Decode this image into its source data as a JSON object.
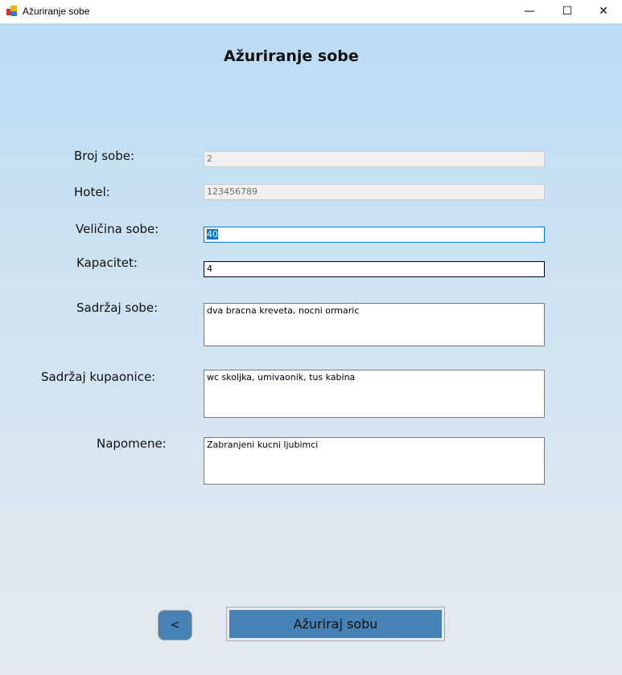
{
  "window": {
    "title": "Ažuriranje sobe",
    "minimize": "—",
    "maximize": "☐",
    "close": "✕"
  },
  "heading": "Ažuriranje sobe",
  "fields": {
    "broj_sobe": {
      "label": "Broj sobe:",
      "value": "2"
    },
    "hotel": {
      "label": "Hotel:",
      "value": "123456789"
    },
    "velicina": {
      "label": "Veličina sobe:",
      "value": "40"
    },
    "kapacitet": {
      "label": "Kapacitet:",
      "value": "4"
    },
    "sadrzaj_sobe": {
      "label": "Sadržaj sobe:",
      "value": "dva bracna kreveta, nocni ormaric"
    },
    "sadrzaj_kupaonice": {
      "label": "Sadržaj kupaonice:",
      "value": "wc skoljka, umivaonik, tus kabina"
    },
    "napomene": {
      "label": "Napomene:",
      "value": "Zabranjeni kucni ljubimci"
    }
  },
  "buttons": {
    "back": "<",
    "update": "Ažuriraj sobu"
  }
}
